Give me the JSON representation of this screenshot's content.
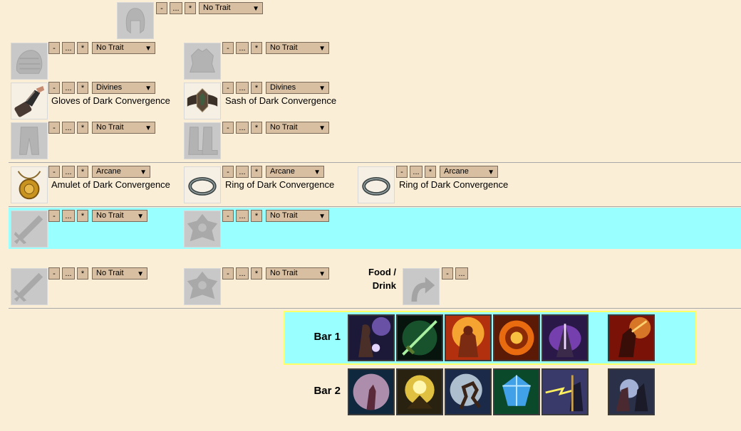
{
  "buttons": {
    "minus": "-",
    "dots": "...",
    "star": "*"
  },
  "gear": {
    "head": {
      "icon": "helmet-icon",
      "trait": "No Trait"
    },
    "shoulders": {
      "icon": "shoulder-armor-icon",
      "trait": "No Trait"
    },
    "chest": {
      "icon": "chest-armor-icon",
      "trait": "No Trait"
    },
    "hands": {
      "icon": "gauntlet-icon",
      "trait": "Divines",
      "name": "Gloves of Dark Convergence"
    },
    "waist": {
      "icon": "belt-icon",
      "trait": "Divines",
      "name": "Sash of Dark Convergence"
    },
    "legs": {
      "icon": "leg-armor-icon",
      "trait": "No Trait"
    },
    "feet": {
      "icon": "boots-icon",
      "trait": "No Trait"
    },
    "neck": {
      "icon": "amulet-icon",
      "trait": "Arcane",
      "name": "Amulet of Dark Convergence"
    },
    "ring1": {
      "icon": "ring-icon",
      "trait": "Arcane",
      "name": "Ring of Dark Convergence"
    },
    "ring2": {
      "icon": "ring-icon",
      "trait": "Arcane",
      "name": "Ring of Dark Convergence"
    },
    "main1": {
      "icon": "sword-icon",
      "trait": "No Trait"
    },
    "off1": {
      "icon": "shield-icon",
      "trait": "No Trait"
    },
    "main2": {
      "icon": "sword-icon",
      "trait": "No Trait"
    },
    "off2": {
      "icon": "shield-icon",
      "trait": "No Trait"
    }
  },
  "food": {
    "label_line1": "Food /",
    "label_line2": "Drink",
    "icon": "arrow-icon"
  },
  "bars": {
    "bar1_label": "Bar 1",
    "bar2_label": "Bar 2",
    "bar1_skills": [
      "skill-purple-caster",
      "skill-green-blade",
      "skill-fire-warrior",
      "skill-fire-orb",
      "skill-violet-tornado",
      "skill-crimson-warrior"
    ],
    "bar2_skills": [
      "skill-pink-sphere",
      "skill-golden-meditation",
      "skill-runner-dash",
      "skill-blue-crystal",
      "skill-lightning-staff",
      "skill-blue-caster"
    ]
  },
  "colors": {
    "background": "#faeed7",
    "highlight": "#99ffff",
    "bar_border": "#ffff66",
    "button": "#d8bfa2"
  }
}
